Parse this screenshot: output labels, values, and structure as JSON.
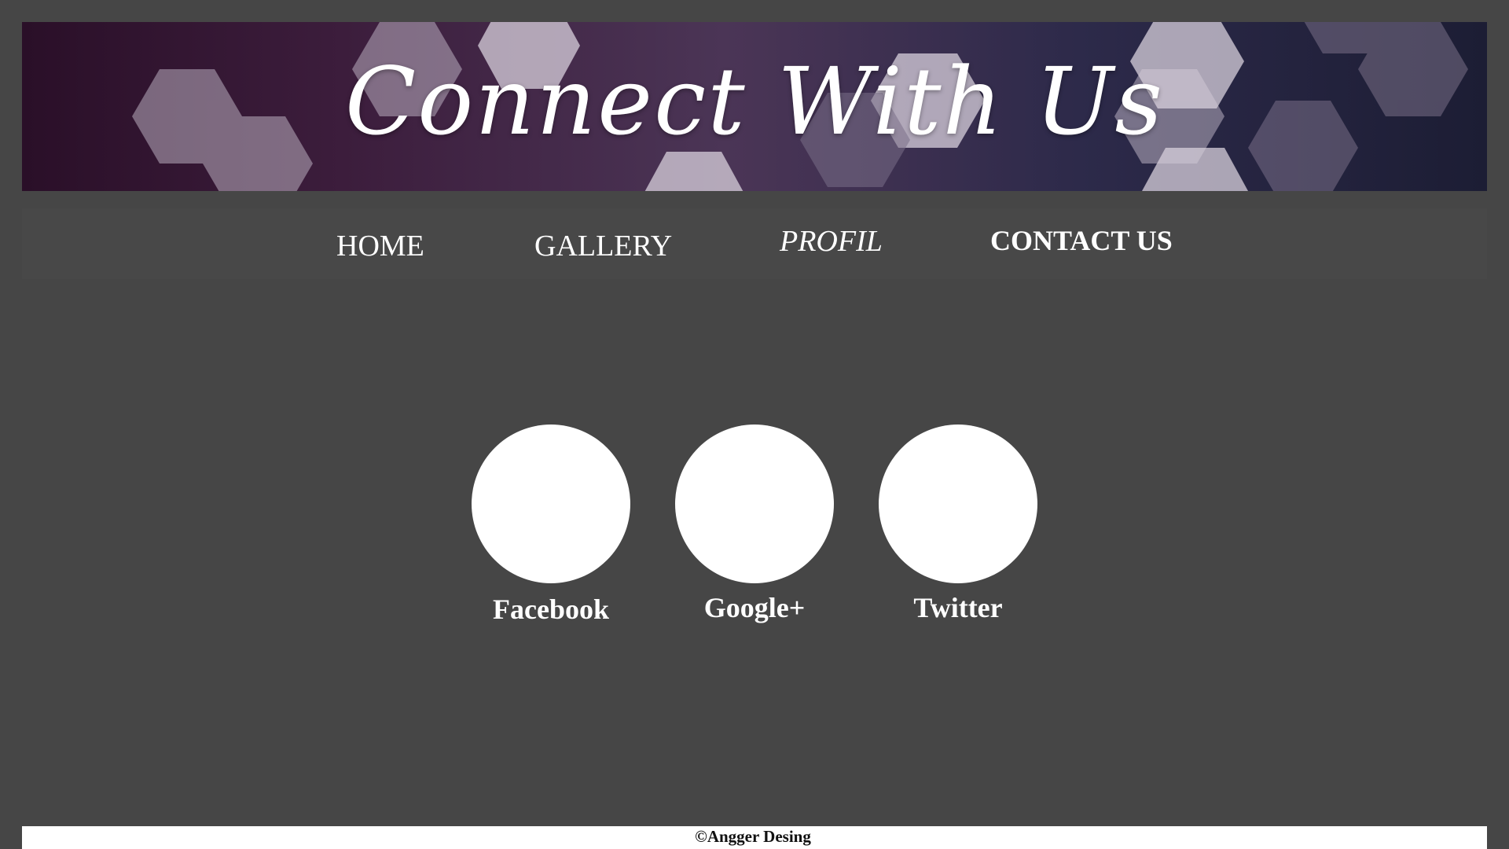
{
  "banner": {
    "title": "Connect With Us"
  },
  "nav": {
    "items": [
      {
        "label": "HOME"
      },
      {
        "label": "GALLERY"
      },
      {
        "label": "PROFIL"
      },
      {
        "label": "CONTACT US"
      }
    ]
  },
  "social": {
    "items": [
      {
        "label": "Facebook"
      },
      {
        "label": "Google+"
      },
      {
        "label": "Twitter"
      }
    ]
  },
  "footer": {
    "text": "©Angger Desing"
  },
  "colors": {
    "page_background": "#464646",
    "nav_background": "#484848",
    "circle": "#ffffff",
    "footer_background": "#ffffff"
  }
}
